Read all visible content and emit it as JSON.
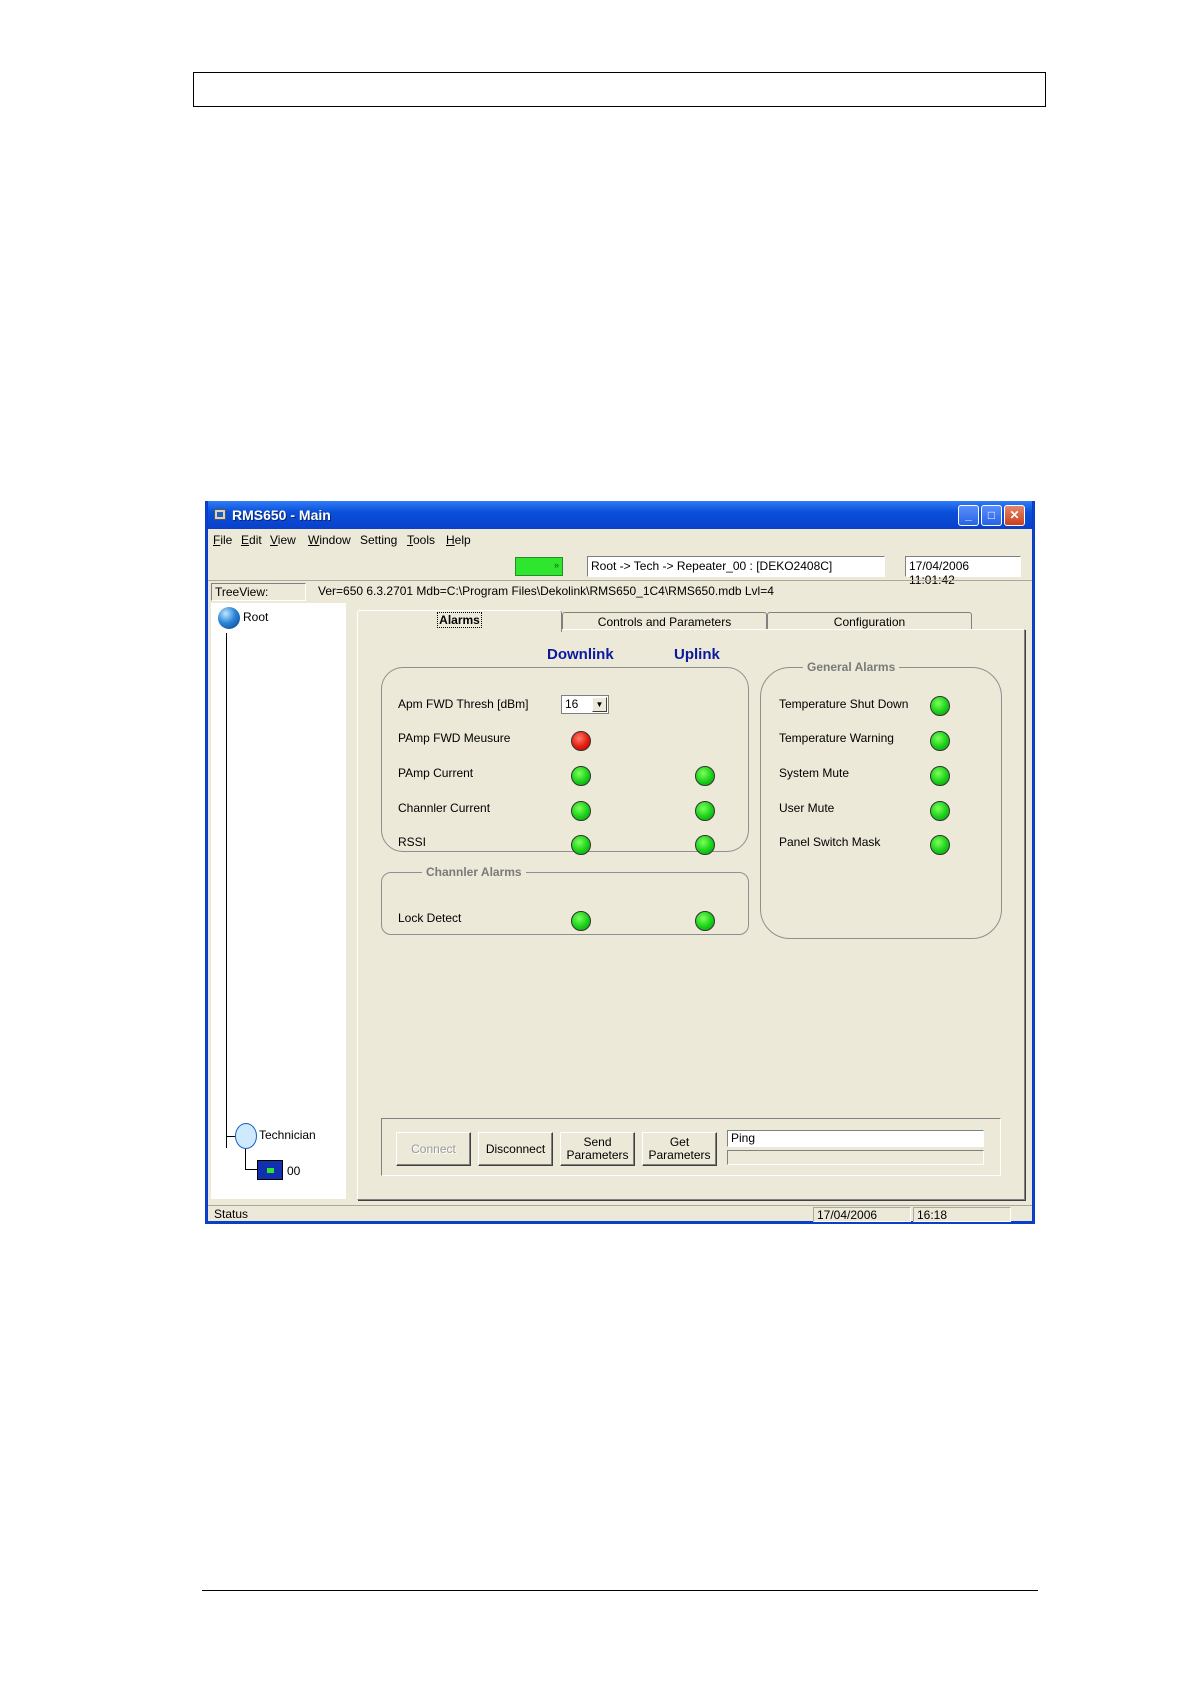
{
  "window": {
    "title": "RMS650 - Main",
    "controls": {
      "minimize": "_",
      "maximize": "□",
      "close": "✕"
    }
  },
  "menu": [
    {
      "label": "File",
      "key": "F",
      "rest": "ile"
    },
    {
      "label": "Edit",
      "key": "E",
      "rest": "dit"
    },
    {
      "label": "View",
      "key": "V",
      "rest": "iew"
    },
    {
      "label": "Window",
      "key": "W",
      "rest": "indow"
    },
    {
      "label": "Setting",
      "key": "",
      "rest": "Setting"
    },
    {
      "label": "Tools",
      "key": "T",
      "rest": "ools"
    },
    {
      "label": "Help",
      "key": "H",
      "rest": "elp"
    }
  ],
  "toolbar": {
    "indicator_text": "»",
    "path": "Root -> Tech -> Repeater_00 : [DEKO2408C]",
    "datetime": "17/04/2006 11:01:42"
  },
  "info": {
    "treeview_label": "TreeView:",
    "version_line": "Ver=650 6.3.2701   Mdb=C:\\Program Files\\Dekolink\\RMS650_1C4\\RMS650.mdb   Lvl=4"
  },
  "tree": {
    "root": "Root",
    "technician": "Technician",
    "node": "00"
  },
  "tabs": [
    "Alarms",
    "Controls and Parameters",
    "Configuration"
  ],
  "alarms": {
    "downlink_header": "Downlink",
    "uplink_header": "Uplink",
    "amp_rows": [
      {
        "label": "Apm FWD Thresh [dBm]",
        "select": "16"
      },
      {
        "label": "PAmp FWD  Meusure",
        "downlink": "red"
      },
      {
        "label": "PAmp Current",
        "downlink": "green",
        "uplink": "green"
      },
      {
        "label": "Channler Current",
        "downlink": "green",
        "uplink": "green"
      },
      {
        "label": "RSSI",
        "downlink": "green",
        "uplink": "green"
      }
    ],
    "channler_title": "Channler Alarms",
    "channler_rows": [
      {
        "label": "Lock Detect",
        "downlink": "green",
        "uplink": "green"
      }
    ],
    "general_title": "General Alarms",
    "general_rows": [
      {
        "label": "Temperature Shut Down",
        "status": "green"
      },
      {
        "label": "Temperature Warning",
        "status": "green"
      },
      {
        "label": "System Mute",
        "status": "green"
      },
      {
        "label": "User Mute",
        "status": "green"
      },
      {
        "label": "Panel Switch Mask",
        "status": "green"
      }
    ]
  },
  "actions": {
    "connect": "Connect",
    "disconnect": "Disconnect",
    "send_line1": "Send",
    "send_line2": "Parameters",
    "get_line1": "Get",
    "get_line2": "Parameters",
    "ping": "Ping"
  },
  "status": {
    "label": "Status",
    "date": "17/04/2006",
    "time": "16:18"
  },
  "colors": {
    "led_green": "#19d019",
    "led_red": "#e61a0e",
    "header_blue": "#0a1aa0",
    "title_bar": "#0a4fd9"
  }
}
